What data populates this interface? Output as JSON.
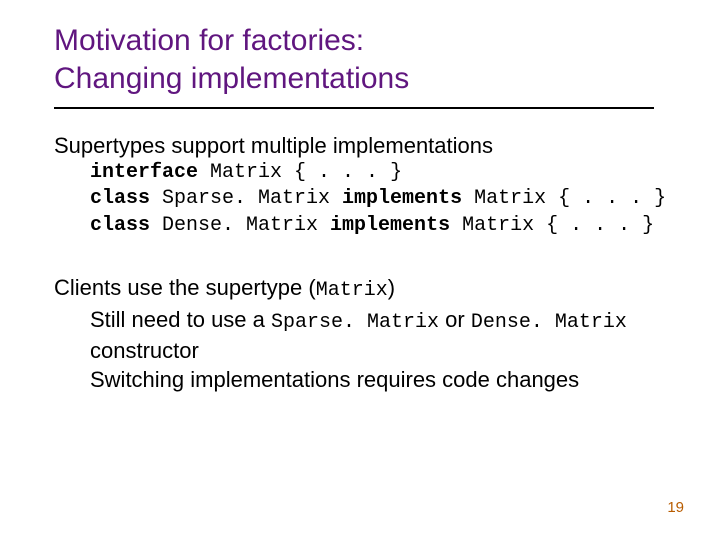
{
  "title_line1": "Motivation for factories:",
  "title_line2": "Changing implementations",
  "line_supertypes": "Supertypes support multiple implementations",
  "code": {
    "l1_kw": "interface",
    "l1_rest": " Matrix { . . . }",
    "l2_kw": "class",
    "l2_mid": " Sparse. Matrix ",
    "l2_kw2": "implements",
    "l2_rest": " Matrix { . . . }",
    "l3_kw": "class",
    "l3_mid": " Dense. Matrix ",
    "l3_kw2": "implements",
    "l3_rest": " Matrix { . . . }"
  },
  "clients_pre": "Clients use the supertype (",
  "clients_code": "Matrix",
  "clients_post": ")",
  "still_pre": "Still need to use a ",
  "still_code1": "Sparse. Matrix",
  "still_mid": " or ",
  "still_code2": "Dense. Matrix",
  "constructor": "constructor",
  "switching": "Switching implementations requires code changes",
  "page": "19"
}
